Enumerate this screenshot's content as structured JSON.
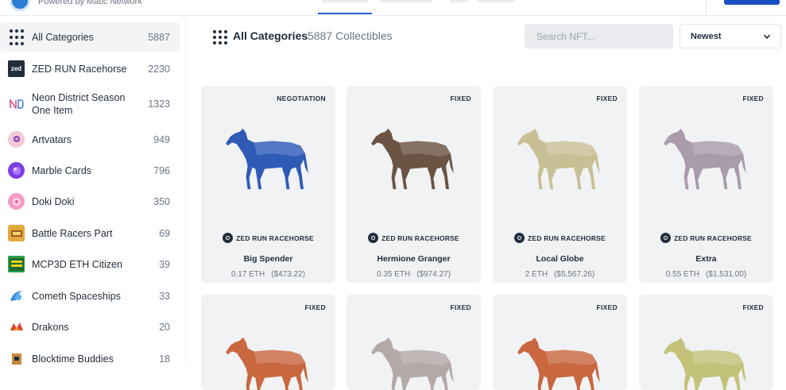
{
  "header": {
    "powered_by": "Powered by Matic Network"
  },
  "sidebar": {
    "items": [
      {
        "label": "All Categories",
        "count": "5887",
        "icon": "grid-icon",
        "color": "#1f2d3d"
      },
      {
        "label": "ZED RUN Racehorse",
        "count": "2230",
        "icon": "zed-icon",
        "color": "#1f2d3d"
      },
      {
        "label": "Neon District Season One Item",
        "count": "1323",
        "icon": "neon-district-icon",
        "color": "#e8eaf2"
      },
      {
        "label": "Artvatars",
        "count": "949",
        "icon": "artvatars-icon",
        "color": "#f4c6d8"
      },
      {
        "label": "Marble Cards",
        "count": "796",
        "icon": "marble-cards-icon",
        "color": "#7b3fe4"
      },
      {
        "label": "Doki Doki",
        "count": "350",
        "icon": "doki-doki-icon",
        "color": "#f49ac4"
      },
      {
        "label": "Battle Racers Part",
        "count": "69",
        "icon": "battle-racers-icon",
        "color": "#e2a93b"
      },
      {
        "label": "MCP3D ETH Citizen",
        "count": "39",
        "icon": "megapolis-icon",
        "color": "#2aa14a"
      },
      {
        "label": "Cometh Spaceships",
        "count": "33",
        "icon": "cometh-icon",
        "color": "#3a8fd8"
      },
      {
        "label": "Drakons",
        "count": "20",
        "icon": "drakons-icon",
        "color": "#d9462f"
      },
      {
        "label": "Blocktime Buddies",
        "count": "18",
        "icon": "blocktime-icon",
        "color": "#c8883a"
      }
    ]
  },
  "main": {
    "title": "All Categories",
    "count_text": "5887 Collectibles",
    "search_placeholder": "Search NFT...",
    "sort_value": "Newest"
  },
  "cards": [
    {
      "badge": "NEGOTIATION",
      "collection": "ZED RUN RACEHORSE",
      "name": "Big Spender",
      "eth": "0.17 ETH",
      "usd": "($473.22)",
      "horse_color": "#2f5bb7"
    },
    {
      "badge": "FIXED",
      "collection": "ZED RUN RACEHORSE",
      "name": "Hermione Granger",
      "eth": "0.35 ETH",
      "usd": "($974.27)",
      "horse_color": "#6b5443"
    },
    {
      "badge": "FIXED",
      "collection": "ZED RUN RACEHORSE",
      "name": "Local Globe",
      "eth": "2 ETH",
      "usd": "($5,567.26)",
      "horse_color": "#c9bf95"
    },
    {
      "badge": "FIXED",
      "collection": "ZED RUN RACEHORSE",
      "name": "Extra",
      "eth": "0.55 ETH",
      "usd": "($1,531.00)",
      "horse_color": "#a99aac"
    },
    {
      "badge": "FIXED",
      "horse_color": "#c9673f"
    },
    {
      "badge": "FIXED",
      "horse_color": "#b3a9a6"
    },
    {
      "badge": "FIXED",
      "horse_color": "#c9673f"
    },
    {
      "badge": "FIXED",
      "horse_color": "#c2c27a"
    }
  ],
  "colors": {
    "accent": "#2b5bd8",
    "cta": "#1a4fc4",
    "card_bg": "#f1f2f4"
  }
}
